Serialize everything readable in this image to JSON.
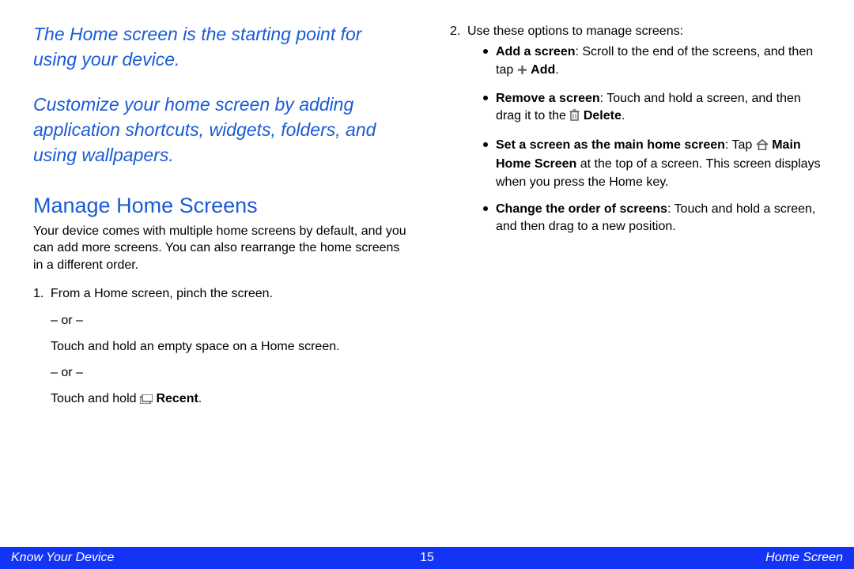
{
  "left": {
    "intro1": "The Home screen is the starting point for using your device.",
    "intro2": "Customize your home screen by adding application shortcuts, widgets, folders, and using wallpapers.",
    "heading": "Manage Home Screens",
    "body": "Your device comes with multiple home screens by default, and you can add more screens. You can also rearrange the home screens in a different order.",
    "step1_lead": "From a Home screen, pinch the screen.",
    "or": "– or –",
    "step1_alt1": "Touch and hold an empty space on a Home screen.",
    "step1_alt2_pre": "Touch and hold ",
    "step1_alt2_icon_label": "Recent"
  },
  "right": {
    "step2_lead": "Use these options to manage screens:",
    "b1_head": "Add a screen",
    "b1_tail_pre": ": Scroll to the end of the screens, and then tap ",
    "b1_tail_icon_label": "Add",
    "b1_tail_post": ".",
    "b2_head": "Remove a screen",
    "b2_tail_pre": ": Touch and hold a screen, and then drag it to the ",
    "b2_tail_icon_label": "Delete",
    "b2_tail_post": ".",
    "b3_head": "Set a screen as the main home screen",
    "b3_tail_pre": ": Tap ",
    "b3_tail_icon_label": "Main Home Screen",
    "b3_tail_post": " at the top of a screen. This screen displays when you press the Home key.",
    "b4_head": "Change the order of screens",
    "b4_tail": ": Touch and hold a screen, and then drag to a new position."
  },
  "footer": {
    "left": "Know Your Device",
    "page": "15",
    "right": "Home Screen"
  }
}
